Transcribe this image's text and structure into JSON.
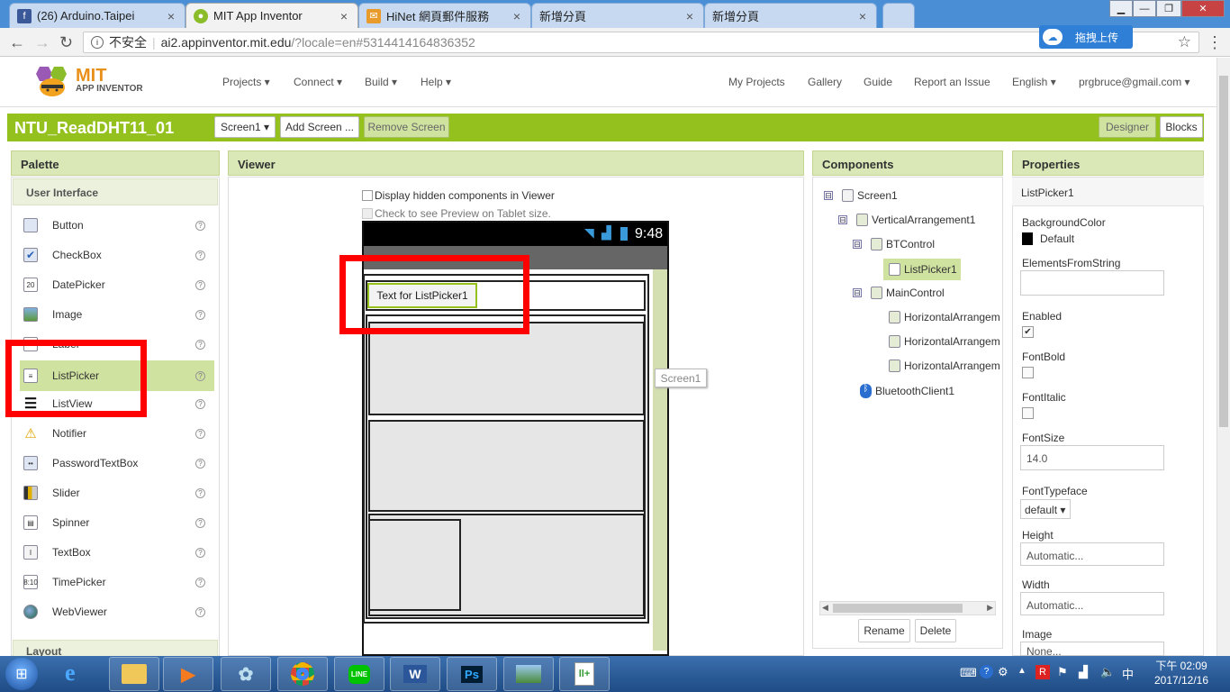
{
  "browser": {
    "tabs": [
      {
        "title": "(26) Arduino.Taipei",
        "favicon": "facebook-icon",
        "color": "#3b5998"
      },
      {
        "title": "MIT App Inventor",
        "favicon": "appinventor-icon",
        "color": "#8bbd2b"
      },
      {
        "title": "HiNet 網頁郵件服務",
        "favicon": "mail-icon",
        "color": "#e89b2a"
      },
      {
        "title": "新增分頁",
        "favicon": "",
        "color": ""
      },
      {
        "title": "新增分頁",
        "favicon": "",
        "color": ""
      }
    ],
    "address": {
      "security_label": "不安全",
      "host": "ai2.appinventor.mit.edu",
      "path": "/?locale=en#5314414164836352"
    },
    "upload_button": "拖拽上传"
  },
  "app": {
    "logo_mit": "MIT",
    "logo_sub": "APP INVENTOR",
    "menu_left": [
      "Projects ▾",
      "Connect ▾",
      "Build ▾",
      "Help ▾"
    ],
    "menu_right": [
      "My Projects",
      "Gallery",
      "Guide",
      "Report an Issue",
      "English ▾",
      "prgbruce@gmail.com ▾"
    ],
    "project_name": "NTU_ReadDHT11_01",
    "screen_select": "Screen1 ▾",
    "add_screen": "Add Screen ...",
    "remove_screen": "Remove Screen",
    "designer": "Designer",
    "blocks": "Blocks",
    "accent": "#95c11f"
  },
  "palette": {
    "title": "Palette",
    "category": "User Interface",
    "items": [
      "Button",
      "CheckBox",
      "DatePicker",
      "Image",
      "Label",
      "ListPicker",
      "ListView",
      "Notifier",
      "PasswordTextBox",
      "Slider",
      "Spinner",
      "TextBox",
      "TimePicker",
      "WebViewer"
    ],
    "help": "?",
    "next_category": "Layout"
  },
  "viewer": {
    "title": "Viewer",
    "hidden_components": "Display hidden components in Viewer",
    "tablet_preview": "Check to see Preview on Tablet size.",
    "time": "9:48",
    "listpicker_text": "Text for ListPicker1",
    "screen_tooltip": "Screen1"
  },
  "components": {
    "title": "Components",
    "tree": [
      {
        "label": "Screen1",
        "toggle": "⊟"
      },
      {
        "label": "VerticalArrangement1",
        "toggle": "⊟"
      },
      {
        "label": "BTControl",
        "toggle": "⊟"
      },
      {
        "label": "ListPicker1",
        "toggle": ""
      },
      {
        "label": "MainControl",
        "toggle": "⊟"
      },
      {
        "label": "HorizontalArrangem",
        "toggle": ""
      },
      {
        "label": "HorizontalArrangem",
        "toggle": ""
      },
      {
        "label": "HorizontalArrangem",
        "toggle": ""
      },
      {
        "label": "BluetoothClient1",
        "toggle": ""
      }
    ],
    "rename": "Rename",
    "delete": "Delete"
  },
  "properties": {
    "title": "Properties",
    "selected": "ListPicker1",
    "background_color_label": "BackgroundColor",
    "background_color_value": "Default",
    "elements_label": "ElementsFromString",
    "elements_value": "",
    "enabled_label": "Enabled",
    "enabled_checked": "✔",
    "fontbold_label": "FontBold",
    "fontitalic_label": "FontItalic",
    "fontsize_label": "FontSize",
    "fontsize_value": "14.0",
    "typeface_label": "FontTypeface",
    "typeface_value": "default ▾",
    "height_label": "Height",
    "height_value": "Automatic...",
    "width_label": "Width",
    "width_value": "Automatic...",
    "image_label": "Image",
    "image_value": "None..."
  },
  "taskbar": {
    "time": "下午 02:09",
    "date": "2017/12/16"
  }
}
